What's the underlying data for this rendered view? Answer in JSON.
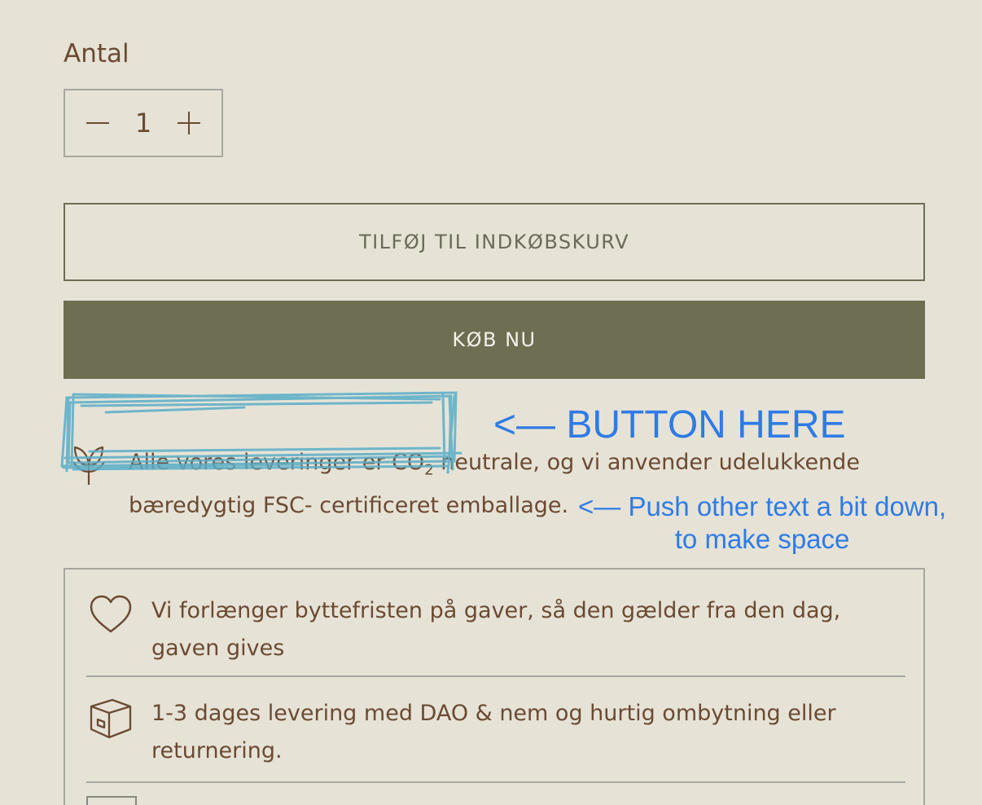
{
  "quantity": {
    "label": "Antal",
    "value": "1",
    "decrement_icon": "minus-icon",
    "increment_icon": "plus-icon"
  },
  "buttons": {
    "add_to_cart": "TILFØJ TIL INDKØBSKURV",
    "buy_now": "KØB NU"
  },
  "annotations": {
    "button_here": "<— BUTTON HERE",
    "push_line1": "<— Push other text a bit down,",
    "push_line2": "to make space",
    "color": "#2f7be6",
    "scribble_color": "#5aaec8"
  },
  "eco": {
    "icon": "leaf-icon",
    "text_before": "Alle vores leveringer er CO",
    "subscript": "2",
    "text_after": " neutrale, og vi anvender udelukkende bæredygtig FSC- certificeret emballage."
  },
  "usps": [
    {
      "icon": "heart-icon",
      "text": "Vi forlænger byttefristen på gaver, så den gælder fra den dag, gaven gives"
    },
    {
      "icon": "box-icon",
      "text": "1-3 dages levering med DAO & nem og hurtig ombytning eller returnering."
    }
  ],
  "colors": {
    "background": "#e6e3d6",
    "text": "#6b4a33",
    "buy_button": "#6e6e52",
    "border": "#a8a69f"
  }
}
